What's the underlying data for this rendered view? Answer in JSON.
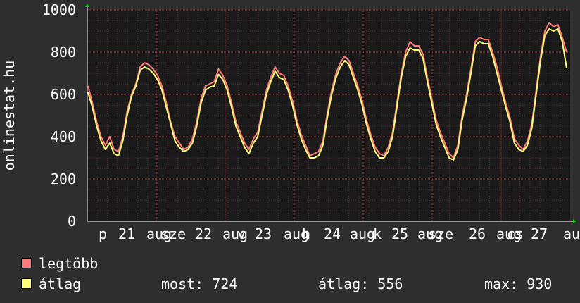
{
  "chart_data": {
    "type": "line",
    "ylabel": "onlinestat.hu",
    "ylim": [
      0,
      1000
    ],
    "yticks": [
      "0",
      "200",
      "400",
      "600",
      "800",
      "1000"
    ],
    "xticks": [
      "p",
      "21",
      "aug",
      "sze",
      "22",
      "aug",
      "v",
      "23",
      "aug",
      "h",
      "24",
      "aug",
      "k",
      "25",
      "aug",
      "sze",
      "26",
      "aug",
      "cs",
      "27",
      "au"
    ],
    "days": 7,
    "series": [
      {
        "name": "legtöbb",
        "color": "#ff7a7a",
        "values": [
          640,
          560,
          470,
          400,
          360,
          400,
          340,
          330,
          400,
          520,
          600,
          650,
          730,
          750,
          740,
          720,
          690,
          640,
          560,
          470,
          400,
          370,
          340,
          350,
          390,
          470,
          580,
          640,
          650,
          660,
          720,
          690,
          640,
          560,
          470,
          420,
          370,
          340,
          390,
          420,
          520,
          620,
          680,
          730,
          700,
          690,
          640,
          570,
          480,
          410,
          360,
          310,
          320,
          330,
          380,
          510,
          620,
          700,
          750,
          780,
          760,
          700,
          640,
          570,
          480,
          410,
          350,
          320,
          310,
          350,
          420,
          560,
          700,
          800,
          850,
          830,
          830,
          790,
          680,
          580,
          480,
          420,
          370,
          320,
          300,
          360,
          500,
          600,
          720,
          850,
          870,
          860,
          860,
          800,
          730,
          640,
          560,
          490,
          390,
          360,
          340,
          380,
          460,
          620,
          780,
          900,
          940,
          920,
          930,
          870,
          800
        ]
      },
      {
        "name": "átlag",
        "color": "#ffff7a",
        "values": [
          610,
          540,
          450,
          380,
          340,
          370,
          320,
          310,
          380,
          500,
          590,
          640,
          715,
          730,
          720,
          700,
          670,
          620,
          540,
          460,
          380,
          350,
          330,
          340,
          370,
          450,
          560,
          620,
          635,
          640,
          695,
          670,
          620,
          540,
          450,
          400,
          350,
          320,
          370,
          400,
          500,
          600,
          660,
          710,
          680,
          670,
          620,
          550,
          460,
          390,
          340,
          300,
          300,
          310,
          360,
          490,
          600,
          680,
          730,
          760,
          740,
          680,
          620,
          550,
          460,
          390,
          330,
          300,
          300,
          330,
          400,
          540,
          680,
          780,
          820,
          810,
          810,
          770,
          660,
          560,
          460,
          400,
          350,
          300,
          290,
          340,
          480,
          580,
          700,
          830,
          850,
          840,
          840,
          780,
          700,
          620,
          540,
          470,
          370,
          340,
          330,
          360,
          440,
          600,
          760,
          880,
          910,
          900,
          910,
          850,
          724
        ]
      }
    ]
  },
  "legend": [
    {
      "label": "legtöbb",
      "color": "#ff7a7a"
    },
    {
      "label": "átlag",
      "color": "#ffff7a"
    }
  ],
  "stats": {
    "most": "most: 724",
    "atlag": "átlag: 556",
    "max": "max: 930"
  }
}
